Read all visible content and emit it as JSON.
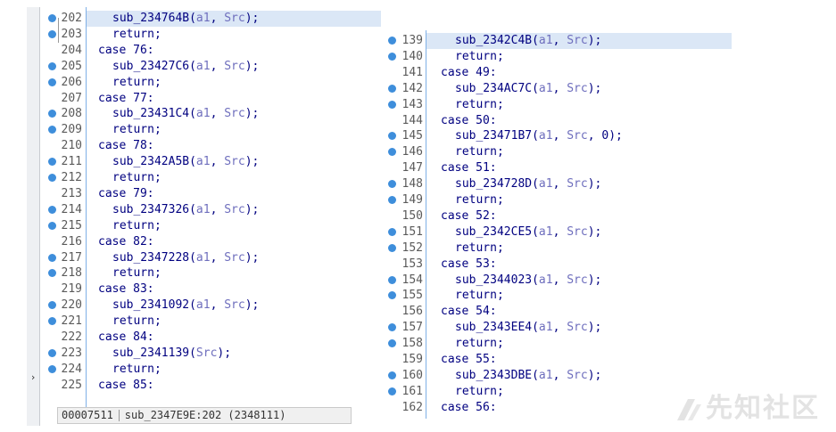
{
  "left_view": {
    "lines": [
      {
        "num": "202",
        "bp": true,
        "indent": 2,
        "parts": [
          [
            "f",
            "sub_234764B("
          ],
          [
            "a",
            "a1"
          ],
          [
            "f",
            ", "
          ],
          [
            "a",
            "Src"
          ],
          [
            "f",
            ");"
          ]
        ],
        "current": true
      },
      {
        "num": "203",
        "bp": true,
        "indent": 2,
        "parts": [
          [
            "f",
            "return;"
          ]
        ]
      },
      {
        "num": "204",
        "bp": false,
        "indent": 1,
        "parts": [
          [
            "f",
            "case 76:"
          ]
        ]
      },
      {
        "num": "205",
        "bp": true,
        "indent": 2,
        "parts": [
          [
            "f",
            "sub_23427C6("
          ],
          [
            "a",
            "a1"
          ],
          [
            "f",
            ", "
          ],
          [
            "a",
            "Src"
          ],
          [
            "f",
            ");"
          ]
        ]
      },
      {
        "num": "206",
        "bp": true,
        "indent": 2,
        "parts": [
          [
            "f",
            "return;"
          ]
        ]
      },
      {
        "num": "207",
        "bp": false,
        "indent": 1,
        "parts": [
          [
            "f",
            "case 77:"
          ]
        ]
      },
      {
        "num": "208",
        "bp": true,
        "indent": 2,
        "parts": [
          [
            "f",
            "sub_23431C4("
          ],
          [
            "a",
            "a1"
          ],
          [
            "f",
            ", "
          ],
          [
            "a",
            "Src"
          ],
          [
            "f",
            ");"
          ]
        ]
      },
      {
        "num": "209",
        "bp": true,
        "indent": 2,
        "parts": [
          [
            "f",
            "return;"
          ]
        ]
      },
      {
        "num": "210",
        "bp": false,
        "indent": 1,
        "parts": [
          [
            "f",
            "case 78:"
          ]
        ]
      },
      {
        "num": "211",
        "bp": true,
        "indent": 2,
        "parts": [
          [
            "f",
            "sub_2342A5B("
          ],
          [
            "a",
            "a1"
          ],
          [
            "f",
            ", "
          ],
          [
            "a",
            "Src"
          ],
          [
            "f",
            ");"
          ]
        ]
      },
      {
        "num": "212",
        "bp": true,
        "indent": 2,
        "parts": [
          [
            "f",
            "return;"
          ]
        ]
      },
      {
        "num": "213",
        "bp": false,
        "indent": 1,
        "parts": [
          [
            "f",
            "case 79:"
          ]
        ]
      },
      {
        "num": "214",
        "bp": true,
        "indent": 2,
        "parts": [
          [
            "f",
            "sub_2347326("
          ],
          [
            "a",
            "a1"
          ],
          [
            "f",
            ", "
          ],
          [
            "a",
            "Src"
          ],
          [
            "f",
            ");"
          ]
        ]
      },
      {
        "num": "215",
        "bp": true,
        "indent": 2,
        "parts": [
          [
            "f",
            "return;"
          ]
        ]
      },
      {
        "num": "216",
        "bp": false,
        "indent": 1,
        "parts": [
          [
            "f",
            "case 82:"
          ]
        ]
      },
      {
        "num": "217",
        "bp": true,
        "indent": 2,
        "parts": [
          [
            "f",
            "sub_2347228("
          ],
          [
            "a",
            "a1"
          ],
          [
            "f",
            ", "
          ],
          [
            "a",
            "Src"
          ],
          [
            "f",
            ");"
          ]
        ]
      },
      {
        "num": "218",
        "bp": true,
        "indent": 2,
        "parts": [
          [
            "f",
            "return;"
          ]
        ]
      },
      {
        "num": "219",
        "bp": false,
        "indent": 1,
        "parts": [
          [
            "f",
            "case 83:"
          ]
        ]
      },
      {
        "num": "220",
        "bp": true,
        "indent": 2,
        "parts": [
          [
            "f",
            "sub_2341092("
          ],
          [
            "a",
            "a1"
          ],
          [
            "f",
            ", "
          ],
          [
            "a",
            "Src"
          ],
          [
            "f",
            ");"
          ]
        ]
      },
      {
        "num": "221",
        "bp": true,
        "indent": 2,
        "parts": [
          [
            "f",
            "return;"
          ]
        ]
      },
      {
        "num": "222",
        "bp": false,
        "indent": 1,
        "parts": [
          [
            "f",
            "case 84:"
          ]
        ]
      },
      {
        "num": "223",
        "bp": true,
        "indent": 2,
        "parts": [
          [
            "f",
            "sub_2341139("
          ],
          [
            "a",
            "Src"
          ],
          [
            "f",
            ");"
          ]
        ]
      },
      {
        "num": "224",
        "bp": true,
        "indent": 2,
        "parts": [
          [
            "f",
            "return;"
          ]
        ]
      },
      {
        "num": "225",
        "bp": false,
        "indent": 1,
        "parts": [
          [
            "f",
            "case 85:"
          ]
        ]
      }
    ],
    "status": {
      "address": "00007511",
      "location": "sub_2347E9E:202 (2348111)"
    },
    "arrow_glyph": "›"
  },
  "right_view": {
    "lines": [
      {
        "num": "139",
        "bp": true,
        "indent": 2,
        "parts": [
          [
            "f",
            "sub_2342C4B("
          ],
          [
            "a",
            "a1"
          ],
          [
            "f",
            ", "
          ],
          [
            "a",
            "Src"
          ],
          [
            "f",
            ");"
          ]
        ],
        "current": true
      },
      {
        "num": "140",
        "bp": true,
        "indent": 2,
        "parts": [
          [
            "f",
            "return;"
          ]
        ]
      },
      {
        "num": "141",
        "bp": false,
        "indent": 1,
        "parts": [
          [
            "f",
            "case 49:"
          ]
        ]
      },
      {
        "num": "142",
        "bp": true,
        "indent": 2,
        "parts": [
          [
            "f",
            "sub_234AC7C("
          ],
          [
            "a",
            "a1"
          ],
          [
            "f",
            ", "
          ],
          [
            "a",
            "Src"
          ],
          [
            "f",
            ");"
          ]
        ]
      },
      {
        "num": "143",
        "bp": true,
        "indent": 2,
        "parts": [
          [
            "f",
            "return;"
          ]
        ]
      },
      {
        "num": "144",
        "bp": false,
        "indent": 1,
        "parts": [
          [
            "f",
            "case 50:"
          ]
        ]
      },
      {
        "num": "145",
        "bp": true,
        "indent": 2,
        "parts": [
          [
            "f",
            "sub_23471B7("
          ],
          [
            "a",
            "a1"
          ],
          [
            "f",
            ", "
          ],
          [
            "a",
            "Src"
          ],
          [
            "f",
            ", 0);"
          ]
        ]
      },
      {
        "num": "146",
        "bp": true,
        "indent": 2,
        "parts": [
          [
            "f",
            "return;"
          ]
        ]
      },
      {
        "num": "147",
        "bp": false,
        "indent": 1,
        "parts": [
          [
            "f",
            "case 51:"
          ]
        ]
      },
      {
        "num": "148",
        "bp": true,
        "indent": 2,
        "parts": [
          [
            "f",
            "sub_234728D("
          ],
          [
            "a",
            "a1"
          ],
          [
            "f",
            ", "
          ],
          [
            "a",
            "Src"
          ],
          [
            "f",
            ");"
          ]
        ]
      },
      {
        "num": "149",
        "bp": true,
        "indent": 2,
        "parts": [
          [
            "f",
            "return;"
          ]
        ]
      },
      {
        "num": "150",
        "bp": false,
        "indent": 1,
        "parts": [
          [
            "f",
            "case 52:"
          ]
        ]
      },
      {
        "num": "151",
        "bp": true,
        "indent": 2,
        "parts": [
          [
            "f",
            "sub_2342CE5("
          ],
          [
            "a",
            "a1"
          ],
          [
            "f",
            ", "
          ],
          [
            "a",
            "Src"
          ],
          [
            "f",
            ");"
          ]
        ]
      },
      {
        "num": "152",
        "bp": true,
        "indent": 2,
        "parts": [
          [
            "f",
            "return;"
          ]
        ]
      },
      {
        "num": "153",
        "bp": false,
        "indent": 1,
        "parts": [
          [
            "f",
            "case 53:"
          ]
        ]
      },
      {
        "num": "154",
        "bp": true,
        "indent": 2,
        "parts": [
          [
            "f",
            "sub_2344023("
          ],
          [
            "a",
            "a1"
          ],
          [
            "f",
            ", "
          ],
          [
            "a",
            "Src"
          ],
          [
            "f",
            ");"
          ]
        ]
      },
      {
        "num": "155",
        "bp": true,
        "indent": 2,
        "parts": [
          [
            "f",
            "return;"
          ]
        ]
      },
      {
        "num": "156",
        "bp": false,
        "indent": 1,
        "parts": [
          [
            "f",
            "case 54:"
          ]
        ]
      },
      {
        "num": "157",
        "bp": true,
        "indent": 2,
        "parts": [
          [
            "f",
            "sub_2343EE4("
          ],
          [
            "a",
            "a1"
          ],
          [
            "f",
            ", "
          ],
          [
            "a",
            "Src"
          ],
          [
            "f",
            ");"
          ]
        ]
      },
      {
        "num": "158",
        "bp": true,
        "indent": 2,
        "parts": [
          [
            "f",
            "return;"
          ]
        ]
      },
      {
        "num": "159",
        "bp": false,
        "indent": 1,
        "parts": [
          [
            "f",
            "case 55:"
          ]
        ]
      },
      {
        "num": "160",
        "bp": true,
        "indent": 2,
        "parts": [
          [
            "f",
            "sub_2343DBE("
          ],
          [
            "a",
            "a1"
          ],
          [
            "f",
            ", "
          ],
          [
            "a",
            "Src"
          ],
          [
            "f",
            ");"
          ]
        ]
      },
      {
        "num": "161",
        "bp": true,
        "indent": 2,
        "parts": [
          [
            "f",
            "return;"
          ]
        ]
      },
      {
        "num": "162",
        "bp": false,
        "indent": 1,
        "parts": [
          [
            "f",
            "case 56:"
          ]
        ]
      }
    ]
  },
  "watermark": {
    "text": "先知社区",
    "icon": "xianzhi-logo-icon"
  },
  "colors": {
    "code_text": "#000080",
    "argument_text": "#6e6ebd",
    "line_number": "#5a5a5a",
    "breakpoint_dot": "#3e8edb",
    "current_line_bg": "#dbe7f6"
  }
}
